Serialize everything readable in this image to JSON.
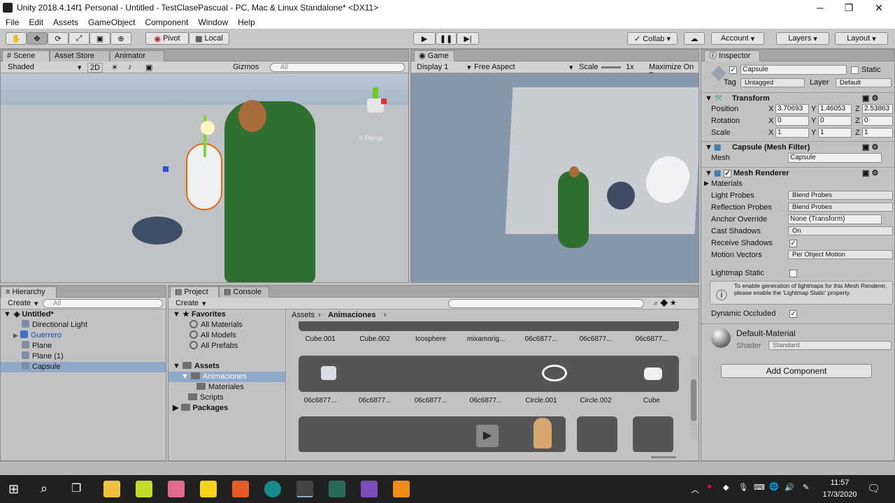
{
  "window": {
    "title": "Unity 2018.4.14f1 Personal - Untitled - TestClasePascual - PC, Mac & Linux Standalone* <DX11>",
    "minimize": "─",
    "maximize": "❐",
    "close": "✕"
  },
  "menu": [
    "File",
    "Edit",
    "Assets",
    "GameObject",
    "Component",
    "Window",
    "Help"
  ],
  "toolbar": {
    "pivot": "Pivot",
    "local": "Local",
    "collab": "Collab ▾",
    "account": "Account",
    "layers": "Layers",
    "layout": "Layout"
  },
  "scene": {
    "tabs": [
      "Scene",
      "Asset Store",
      "Animator"
    ],
    "shading": "Shaded",
    "mode2d": "2D",
    "gizmos": "Gizmos",
    "search": "All",
    "persp": "< Persp"
  },
  "game": {
    "tab": "Game",
    "display": "Display 1",
    "aspect": "Free Aspect",
    "scale_label": "Scale",
    "scale_value": "1x",
    "maximize": "Maximize On P"
  },
  "hierarchy": {
    "tab": "Hierarchy",
    "create": "Create",
    "search": "All",
    "scene": "Untitled*",
    "items": [
      "Directional Light",
      "Guerrero",
      "Plane",
      "Plane (1)",
      "Capsule"
    ]
  },
  "project": {
    "tabs": [
      "Project",
      "Console"
    ],
    "create": "Create",
    "favorites": {
      "title": "Favorites",
      "items": [
        "All Materials",
        "All Models",
        "All Prefabs"
      ]
    },
    "assets": {
      "title": "Assets",
      "items": [
        "Animaciones",
        "Materiales",
        "Scripts"
      ]
    },
    "packages": "Packages",
    "breadcrumb": [
      "Assets",
      "Animaciones"
    ],
    "row1": [
      "Cube.001",
      "Cube.002",
      "Icosphere",
      "mixamorig...",
      "06c6877...",
      "06c6877...",
      "06c6877..."
    ],
    "row2": [
      "06c6877...",
      "06c6877...",
      "06c6877...",
      "06c6877...",
      "Circle.001",
      "Circle.002",
      "Cube"
    ]
  },
  "inspector": {
    "tab": "Inspector",
    "name": "Capsule",
    "static": "Static",
    "tag_label": "Tag",
    "tag": "Untagged",
    "layer_label": "Layer",
    "layer": "Default",
    "transform": {
      "title": "Transform",
      "position_label": "Position",
      "rotation_label": "Rotation",
      "scale_label": "Scale",
      "position": [
        "3.70693",
        "1.46053",
        "2.53863"
      ],
      "rotation": [
        "0",
        "0",
        "0"
      ],
      "scale": [
        "1",
        "1",
        "1"
      ]
    },
    "meshfilter": {
      "title": "Capsule (Mesh Filter)",
      "mesh_label": "Mesh",
      "mesh": "Capsule"
    },
    "renderer": {
      "title": "Mesh Renderer",
      "materials": "Materials",
      "light_probes_label": "Light Probes",
      "light_probes": "Blend Probes",
      "reflection_label": "Reflection Probes",
      "reflection": "Blend Probes",
      "anchor_label": "Anchor Override",
      "anchor": "None (Transform)",
      "cast_label": "Cast Shadows",
      "cast": "On",
      "receive_label": "Receive Shadows",
      "motion_label": "Motion Vectors",
      "motion": "Per Object Motion",
      "lightmap_label": "Lightmap Static",
      "help": "To enable generation of lightmaps for this Mesh Renderer, please enable the 'Lightmap Static' property.",
      "occluded_label": "Dynamic Occluded"
    },
    "material": {
      "name": "Default-Material",
      "shader_label": "Shader",
      "shader": "Standard"
    },
    "add_component": "Add Component"
  },
  "taskbar": {
    "time": "11:57",
    "date": "17/3/2020"
  }
}
